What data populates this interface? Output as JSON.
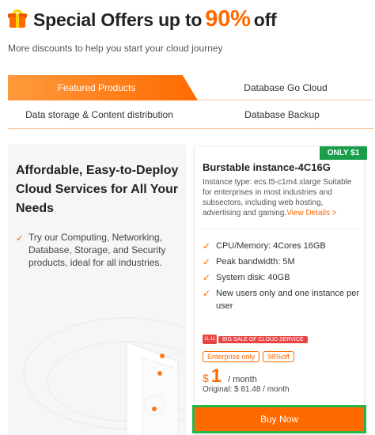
{
  "hero": {
    "title_prefix": "Special Offers up to",
    "title_percent": "90%",
    "title_suffix": "off",
    "subtitle": "More discounts to help you start your cloud journey"
  },
  "tabs": [
    {
      "label": "Featured Products",
      "active": true
    },
    {
      "label": "Database Go Cloud",
      "active": false
    },
    {
      "label": "Data storage & Content distribution",
      "active": false
    },
    {
      "label": "Database Backup",
      "active": false
    }
  ],
  "left_panel": {
    "heading": "Affordable, Easy-to-Deploy Cloud Services for All Your Needs",
    "bullet": "Try our Computing, Networking, Database, Storage, and Security products, ideal for all industries."
  },
  "card": {
    "badge": "ONLY $1",
    "title": "Burstable instance-4C16G",
    "description": "Instance type: ecs.t5-c1m4.xlarge Suitable for enterprises in most industries and subsectors, including web hosting, advertising and gaming.",
    "view_details": "View Details >",
    "specs": [
      "CPU/Memory: 4Cores 16GB",
      "Peak bandwidth: 5M",
      "System disk: 40GB",
      "New users only and one instance per user"
    ],
    "sale_logo": "11.11",
    "sale_label": "BIG SALE OF CLOUD SERVICE",
    "tags": [
      "Enterprise only",
      "98%off"
    ],
    "currency": "$",
    "price": "1",
    "per": "/ month",
    "original": "Original: $ 81.48 / month",
    "buy_label": "Buy Now"
  },
  "colors": {
    "accent": "#ff6a00",
    "badge_green": "#1a9e4c",
    "highlight_border": "#22b84a"
  }
}
